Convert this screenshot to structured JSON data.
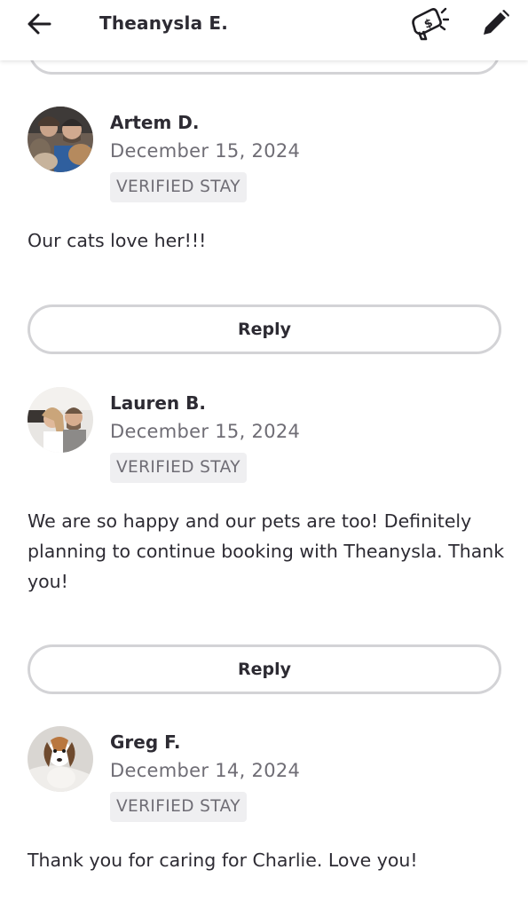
{
  "header": {
    "title": "Theanysla E.",
    "icons": [
      "back-arrow-icon",
      "megaphone-dollar-icon",
      "pencil-icon"
    ]
  },
  "reviews": [
    {
      "name": "Artem D.",
      "date": "December 15, 2024",
      "badge": "VERIFIED STAY",
      "text": "Our cats love her!!!",
      "reply_label": "Reply"
    },
    {
      "name": "Lauren B.",
      "date": "December 15, 2024",
      "badge": "VERIFIED STAY",
      "text": "We are so happy and our pets are too! Definitely planning to continue booking with Theanysla. Thank you!",
      "reply_label": "Reply"
    },
    {
      "name": "Greg F.",
      "date": "December 14, 2024",
      "badge": "VERIFIED STAY",
      "text": "Thank you for caring for Charlie. Love you!"
    }
  ],
  "colors": {
    "text": "#2d2b33",
    "muted": "#6f6d75",
    "badge_bg": "#efeff1",
    "button_border": "#d3d3d6"
  }
}
